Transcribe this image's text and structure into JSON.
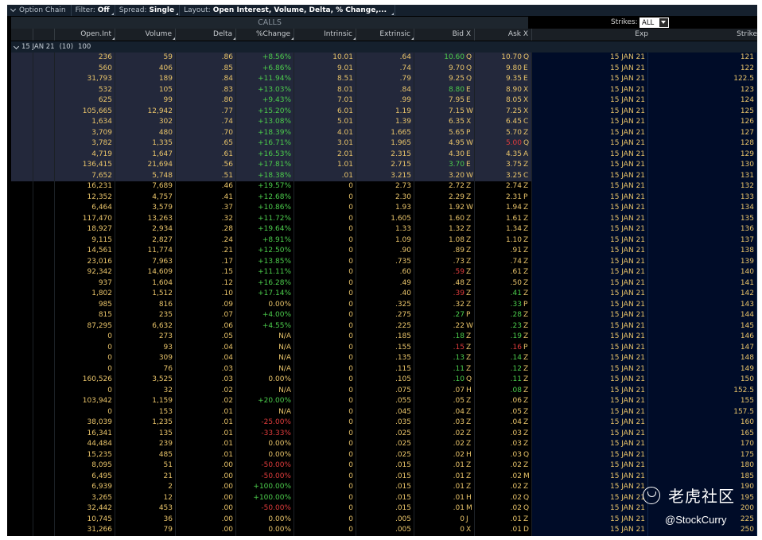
{
  "topbar": {
    "title": "Option Chain",
    "filter_label": "Filter:",
    "filter_value": "Off",
    "spread_label": "Spread:",
    "spread_value": "Single",
    "layout_label": "Layout:",
    "layout_value": "Open Interest, Volume, Delta, % Change,..."
  },
  "calls_band": "CALLS",
  "strikes": {
    "label": "Strikes:",
    "value": "ALL"
  },
  "columns": [
    "Open.Int",
    "Volume",
    "Delta",
    "%Change",
    "Intrinsic",
    "Extrinsic",
    "Bid X",
    "Ask X",
    "Exp",
    "Strike"
  ],
  "group": {
    "exp": "15 JAN 21",
    "days": "(10)",
    "mult": "100"
  },
  "rows": [
    {
      "oi": "236",
      "vol": "59",
      "delta": ".86",
      "chg": "+8.56%",
      "intr": "10.01",
      "extr": ".64",
      "bid": "10.60",
      "bx": "Q",
      "ask": "10.70",
      "ax": "Q",
      "exp": "15 JAN 21",
      "strike": "121",
      "itm": true,
      "bu": true
    },
    {
      "oi": "560",
      "vol": "406",
      "delta": ".85",
      "chg": "+6.86%",
      "intr": "9.01",
      "extr": ".74",
      "bid": "9.70",
      "bx": "Q",
      "ask": "9.80",
      "ax": "E",
      "exp": "15 JAN 21",
      "strike": "122",
      "itm": true
    },
    {
      "oi": "31,793",
      "vol": "189",
      "delta": ".84",
      "chg": "+11.94%",
      "intr": "8.51",
      "extr": ".79",
      "bid": "9.25",
      "bx": "Q",
      "ask": "9.35",
      "ax": "E",
      "exp": "15 JAN 21",
      "strike": "122.5",
      "itm": true
    },
    {
      "oi": "532",
      "vol": "105",
      "delta": ".83",
      "chg": "+13.03%",
      "intr": "8.01",
      "extr": ".84",
      "bid": "8.80",
      "bx": "E",
      "ask": "8.90",
      "ax": "X",
      "exp": "15 JAN 21",
      "strike": "123",
      "itm": true,
      "bu": true
    },
    {
      "oi": "625",
      "vol": "99",
      "delta": ".80",
      "chg": "+9.43%",
      "intr": "7.01",
      "extr": ".99",
      "bid": "7.95",
      "bx": "E",
      "ask": "8.05",
      "ax": "X",
      "exp": "15 JAN 21",
      "strike": "124",
      "itm": true
    },
    {
      "oi": "105,665",
      "vol": "12,942",
      "delta": ".77",
      "chg": "+15.20%",
      "intr": "6.01",
      "extr": "1.19",
      "bid": "7.15",
      "bx": "W",
      "ask": "7.25",
      "ax": "X",
      "exp": "15 JAN 21",
      "strike": "125",
      "itm": true
    },
    {
      "oi": "1,634",
      "vol": "302",
      "delta": ".74",
      "chg": "+13.08%",
      "intr": "5.01",
      "extr": "1.39",
      "bid": "6.35",
      "bx": "X",
      "ask": "6.45",
      "ax": "C",
      "exp": "15 JAN 21",
      "strike": "126",
      "itm": true
    },
    {
      "oi": "3,709",
      "vol": "480",
      "delta": ".70",
      "chg": "+18.39%",
      "intr": "4.01",
      "extr": "1.665",
      "bid": "5.65",
      "bx": "P",
      "ask": "5.70",
      "ax": "Z",
      "exp": "15 JAN 21",
      "strike": "127",
      "itm": true
    },
    {
      "oi": "3,782",
      "vol": "1,335",
      "delta": ".65",
      "chg": "+16.71%",
      "intr": "3.01",
      "extr": "1.965",
      "bid": "4.95",
      "bx": "W",
      "ask": "5.00",
      "ax": "Q",
      "exp": "15 JAN 21",
      "strike": "128",
      "itm": true,
      "ad": true
    },
    {
      "oi": "4,719",
      "vol": "1,647",
      "delta": ".61",
      "chg": "+16.53%",
      "intr": "2.01",
      "extr": "2.315",
      "bid": "4.30",
      "bx": "E",
      "ask": "4.35",
      "ax": "A",
      "exp": "15 JAN 21",
      "strike": "129",
      "itm": true
    },
    {
      "oi": "136,415",
      "vol": "21,694",
      "delta": ".56",
      "chg": "+17.81%",
      "intr": "1.01",
      "extr": "2.715",
      "bid": "3.70",
      "bx": "E",
      "ask": "3.75",
      "ax": "Z",
      "exp": "15 JAN 21",
      "strike": "130",
      "itm": true,
      "bu": true
    },
    {
      "oi": "7,652",
      "vol": "5,748",
      "delta": ".51",
      "chg": "+18.38%",
      "intr": ".01",
      "extr": "3.215",
      "bid": "3.20",
      "bx": "W",
      "ask": "3.25",
      "ax": "C",
      "exp": "15 JAN 21",
      "strike": "131",
      "itm": true
    },
    {
      "oi": "16,231",
      "vol": "7,689",
      "delta": ".46",
      "chg": "+19.57%",
      "intr": "0",
      "extr": "2.73",
      "bid": "2.72",
      "bx": "Z",
      "ask": "2.74",
      "ax": "Z",
      "exp": "15 JAN 21",
      "strike": "132"
    },
    {
      "oi": "12,352",
      "vol": "4,757",
      "delta": ".41",
      "chg": "+12.68%",
      "intr": "0",
      "extr": "2.30",
      "bid": "2.29",
      "bx": "Z",
      "ask": "2.31",
      "ax": "P",
      "exp": "15 JAN 21",
      "strike": "133"
    },
    {
      "oi": "6,464",
      "vol": "3,579",
      "delta": ".37",
      "chg": "+10.86%",
      "intr": "0",
      "extr": "1.93",
      "bid": "1.92",
      "bx": "W",
      "ask": "1.94",
      "ax": "Z",
      "exp": "15 JAN 21",
      "strike": "134"
    },
    {
      "oi": "117,470",
      "vol": "13,263",
      "delta": ".32",
      "chg": "+11.72%",
      "intr": "0",
      "extr": "1.605",
      "bid": "1.60",
      "bx": "Z",
      "ask": "1.61",
      "ax": "Z",
      "exp": "15 JAN 21",
      "strike": "135"
    },
    {
      "oi": "18,927",
      "vol": "2,934",
      "delta": ".28",
      "chg": "+19.64%",
      "intr": "0",
      "extr": "1.33",
      "bid": "1.32",
      "bx": "Z",
      "ask": "1.34",
      "ax": "Z",
      "exp": "15 JAN 21",
      "strike": "136"
    },
    {
      "oi": "9,115",
      "vol": "2,827",
      "delta": ".24",
      "chg": "+8.91%",
      "intr": "0",
      "extr": "1.09",
      "bid": "1.08",
      "bx": "Z",
      "ask": "1.10",
      "ax": "Z",
      "exp": "15 JAN 21",
      "strike": "137"
    },
    {
      "oi": "14,561",
      "vol": "11,774",
      "delta": ".21",
      "chg": "+12.50%",
      "intr": "0",
      "extr": ".90",
      "bid": ".89",
      "bx": "Z",
      "ask": ".91",
      "ax": "Z",
      "exp": "15 JAN 21",
      "strike": "138"
    },
    {
      "oi": "23,016",
      "vol": "7,963",
      "delta": ".17",
      "chg": "+13.85%",
      "intr": "0",
      "extr": ".735",
      "bid": ".73",
      "bx": "Z",
      "ask": ".74",
      "ax": "Z",
      "exp": "15 JAN 21",
      "strike": "139"
    },
    {
      "oi": "92,342",
      "vol": "14,609",
      "delta": ".15",
      "chg": "+11.11%",
      "intr": "0",
      "extr": ".60",
      "bid": ".59",
      "bx": "Z",
      "ask": ".61",
      "ax": "Z",
      "exp": "15 JAN 21",
      "strike": "140",
      "bd": true
    },
    {
      "oi": "937",
      "vol": "1,604",
      "delta": ".12",
      "chg": "+16.28%",
      "intr": "0",
      "extr": ".49",
      "bid": ".48",
      "bx": "Z",
      "ask": ".50",
      "ax": "Z",
      "exp": "15 JAN 21",
      "strike": "141"
    },
    {
      "oi": "1,802",
      "vol": "1,512",
      "delta": ".10",
      "chg": "+17.14%",
      "intr": "0",
      "extr": ".40",
      "bid": ".39",
      "bx": "Z",
      "ask": ".41",
      "ax": "Z",
      "exp": "15 JAN 21",
      "strike": "142",
      "bd": true,
      "au": true
    },
    {
      "oi": "985",
      "vol": "816",
      "delta": ".09",
      "chg": "0.00%",
      "intr": "0",
      "extr": ".325",
      "bid": ".32",
      "bx": "Z",
      "ask": ".33",
      "ax": "P",
      "exp": "15 JAN 21",
      "strike": "143",
      "au": true,
      "flat": true
    },
    {
      "oi": "815",
      "vol": "235",
      "delta": ".07",
      "chg": "+4.00%",
      "intr": "0",
      "extr": ".275",
      "bid": ".27",
      "bx": "P",
      "ask": ".28",
      "ax": "Z",
      "exp": "15 JAN 21",
      "strike": "144",
      "bu": true,
      "au": true
    },
    {
      "oi": "87,295",
      "vol": "6,632",
      "delta": ".06",
      "chg": "+4.55%",
      "intr": "0",
      "extr": ".225",
      "bid": ".22",
      "bx": "W",
      "ask": ".23",
      "ax": "Z",
      "exp": "15 JAN 21",
      "strike": "145",
      "au": true
    },
    {
      "oi": "0",
      "vol": "273",
      "delta": ".05",
      "chg": "N/A",
      "intr": "0",
      "extr": ".185",
      "bid": ".18",
      "bx": "Z",
      "ask": ".19",
      "ax": "Z",
      "exp": "15 JAN 21",
      "strike": "146",
      "bu": true,
      "au": true,
      "flat": true
    },
    {
      "oi": "0",
      "vol": "93",
      "delta": ".04",
      "chg": "N/A",
      "intr": "0",
      "extr": ".155",
      "bid": ".15",
      "bx": "Z",
      "ask": ".16",
      "ax": "P",
      "exp": "15 JAN 21",
      "strike": "147",
      "bd": true,
      "ad": true,
      "flat": true
    },
    {
      "oi": "0",
      "vol": "309",
      "delta": ".04",
      "chg": "N/A",
      "intr": "0",
      "extr": ".135",
      "bid": ".13",
      "bx": "Z",
      "ask": ".14",
      "ax": "Z",
      "exp": "15 JAN 21",
      "strike": "148",
      "bu": true,
      "au": true,
      "flat": true
    },
    {
      "oi": "0",
      "vol": "76",
      "delta": ".03",
      "chg": "N/A",
      "intr": "0",
      "extr": ".115",
      "bid": ".11",
      "bx": "Z",
      "ask": ".12",
      "ax": "Z",
      "exp": "15 JAN 21",
      "strike": "149",
      "bu": true,
      "au": true,
      "flat": true
    },
    {
      "oi": "160,526",
      "vol": "3,525",
      "delta": ".03",
      "chg": "0.00%",
      "intr": "0",
      "extr": ".105",
      "bid": ".10",
      "bx": "Q",
      "ask": ".11",
      "ax": "Z",
      "exp": "15 JAN 21",
      "strike": "150",
      "bu": true,
      "au": true,
      "flat": true
    },
    {
      "oi": "0",
      "vol": "32",
      "delta": ".02",
      "chg": "N/A",
      "intr": "0",
      "extr": ".075",
      "bid": ".07",
      "bx": "H",
      "ask": ".08",
      "ax": "Z",
      "exp": "15 JAN 21",
      "strike": "152.5",
      "au": true,
      "flat": true
    },
    {
      "oi": "103,942",
      "vol": "1,159",
      "delta": ".02",
      "chg": "+20.00%",
      "intr": "0",
      "extr": ".055",
      "bid": ".05",
      "bx": "Z",
      "ask": ".06",
      "ax": "Z",
      "exp": "15 JAN 21",
      "strike": "155"
    },
    {
      "oi": "0",
      "vol": "153",
      "delta": ".01",
      "chg": "N/A",
      "intr": "0",
      "extr": ".045",
      "bid": ".04",
      "bx": "Z",
      "ask": ".05",
      "ax": "Z",
      "exp": "15 JAN 21",
      "strike": "157.5",
      "flat": true
    },
    {
      "oi": "38,039",
      "vol": "1,235",
      "delta": ".01",
      "chg": "-25.00%",
      "intr": "0",
      "extr": ".035",
      "bid": ".03",
      "bx": "Z",
      "ask": ".04",
      "ax": "Z",
      "exp": "15 JAN 21",
      "strike": "160"
    },
    {
      "oi": "16,341",
      "vol": "135",
      "delta": ".01",
      "chg": "-33.33%",
      "intr": "0",
      "extr": ".025",
      "bid": ".02",
      "bx": "Z",
      "ask": ".03",
      "ax": "Z",
      "exp": "15 JAN 21",
      "strike": "165"
    },
    {
      "oi": "44,484",
      "vol": "239",
      "delta": ".01",
      "chg": "0.00%",
      "intr": "0",
      "extr": ".025",
      "bid": ".02",
      "bx": "Z",
      "ask": ".03",
      "ax": "Z",
      "exp": "15 JAN 21",
      "strike": "170",
      "flat": true
    },
    {
      "oi": "15,235",
      "vol": "485",
      "delta": ".01",
      "chg": "0.00%",
      "intr": "0",
      "extr": ".025",
      "bid": ".02",
      "bx": "H",
      "ask": ".03",
      "ax": "Q",
      "exp": "15 JAN 21",
      "strike": "175",
      "flat": true
    },
    {
      "oi": "8,095",
      "vol": "51",
      "delta": ".00",
      "chg": "-50.00%",
      "intr": "0",
      "extr": ".015",
      "bid": ".01",
      "bx": "Z",
      "ask": ".02",
      "ax": "Z",
      "exp": "15 JAN 21",
      "strike": "180"
    },
    {
      "oi": "6,495",
      "vol": "21",
      "delta": ".00",
      "chg": "-50.00%",
      "intr": "0",
      "extr": ".015",
      "bid": ".01",
      "bx": "Z",
      "ask": ".02",
      "ax": "M",
      "exp": "15 JAN 21",
      "strike": "185"
    },
    {
      "oi": "6,939",
      "vol": "2",
      "delta": ".00",
      "chg": "+100.00%",
      "intr": "0",
      "extr": ".015",
      "bid": ".01",
      "bx": "Z",
      "ask": ".02",
      "ax": "Z",
      "exp": "15 JAN 21",
      "strike": "190"
    },
    {
      "oi": "3,265",
      "vol": "12",
      "delta": ".00",
      "chg": "+100.00%",
      "intr": "0",
      "extr": ".015",
      "bid": ".01",
      "bx": "H",
      "ask": ".02",
      "ax": "Q",
      "exp": "15 JAN 21",
      "strike": "195"
    },
    {
      "oi": "32,442",
      "vol": "453",
      "delta": ".00",
      "chg": "-50.00%",
      "intr": "0",
      "extr": ".015",
      "bid": ".01",
      "bx": "M",
      "ask": ".02",
      "ax": "Q",
      "exp": "15 JAN 21",
      "strike": "200"
    },
    {
      "oi": "10,745",
      "vol": "36",
      "delta": ".00",
      "chg": "0.00%",
      "intr": "0",
      "extr": ".005",
      "bid": "0",
      "bx": "J",
      "ask": ".01",
      "ax": "Z",
      "exp": "15 JAN 21",
      "strike": "225",
      "flat": true
    },
    {
      "oi": "31,266",
      "vol": "79",
      "delta": ".00",
      "chg": "0.00%",
      "intr": "0",
      "extr": ".005",
      "bid": "0",
      "bx": "X",
      "ask": ".01",
      "ax": "D",
      "exp": "15 JAN 21",
      "strike": "250",
      "flat": true
    }
  ],
  "watermark": {
    "brand": "老虎社区",
    "handle": "@StockCurry"
  },
  "colors": {
    "up": "#4ccd4c",
    "down": "#e03c3c",
    "value": "#e9c46a",
    "itm_bg": "#23283b",
    "strike_bg": "#000c28"
  }
}
